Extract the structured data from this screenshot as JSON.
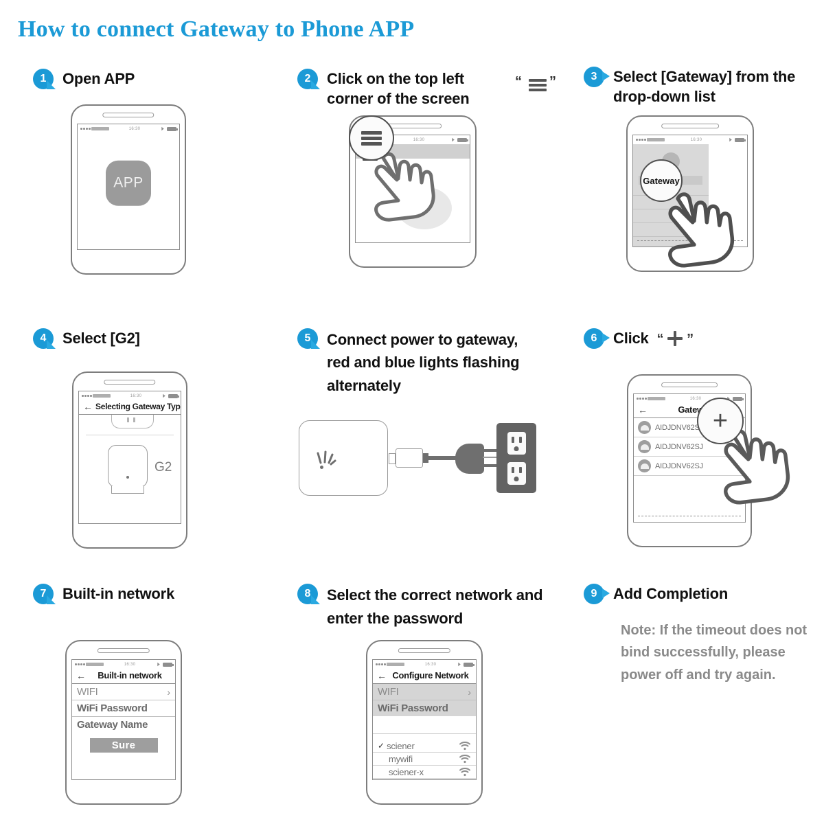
{
  "title": "How to connect Gateway to Phone APP",
  "theme": {
    "accent": "#1b9ad6",
    "badge": "#29a9e1",
    "grey": "#9a9a9a",
    "note": "#8a8a8a"
  },
  "steps": [
    {
      "num": "1",
      "title": "Open APP"
    },
    {
      "num": "2",
      "title_line1": "Click on the top left",
      "title_line2": "corner of the screen",
      "quote_open": "“",
      "quote_close": "”",
      "icon": "hamburger-icon"
    },
    {
      "num": "3",
      "title_line1": "Select [Gateway] from the",
      "title_line2": "drop-down list"
    },
    {
      "num": "4",
      "title": "Select [G2]"
    },
    {
      "num": "5",
      "title_line1": "Connect power to gateway,",
      "title_line2": "red and blue lights flashing",
      "title_line3": "alternately"
    },
    {
      "num": "6",
      "title": "Click",
      "quote_open": "“",
      "quote_close": "”",
      "icon": "plus-icon"
    },
    {
      "num": "7",
      "title": "Built-in network"
    },
    {
      "num": "8",
      "title_line1": "Select the correct network and",
      "title_line2": "enter the password"
    },
    {
      "num": "9",
      "title": "Add Completion",
      "note_line1": "Note: If the timeout does not",
      "note_line2": "bind successfully, please",
      "note_line3": "power off and try again."
    }
  ],
  "statusbar": {
    "time": "16:30"
  },
  "phone1": {
    "app_icon_label": "APP"
  },
  "phone3": {
    "magnifier_label": "Gateway"
  },
  "phone4": {
    "appbar_title": "Selecting Gateway Type",
    "device_label": "G2"
  },
  "phone6": {
    "appbar_title": "Gateway",
    "items": [
      "AIDJDNV62SJ",
      "AIDJDNV62SJ",
      "AIDJDNV62SJ"
    ],
    "magnifier_label": "+"
  },
  "phone7": {
    "appbar_title": "Built-in network",
    "rows": [
      "WIFI",
      "WiFi Password",
      "Gateway Name"
    ],
    "chevron": "›",
    "button_label": "Sure"
  },
  "phone8": {
    "appbar_title": "Configure Network",
    "rows": [
      "WIFI",
      "WiFi Password"
    ],
    "chevron": "›",
    "networks": [
      {
        "name": "sciener",
        "selected": true
      },
      {
        "name": "mywifi",
        "selected": false
      },
      {
        "name": "sciener-x",
        "selected": false
      }
    ],
    "check_glyph": "✓"
  }
}
